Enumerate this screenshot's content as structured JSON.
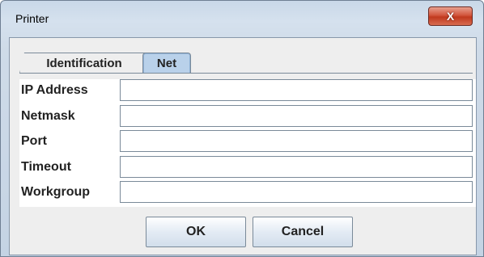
{
  "window": {
    "title": "Printer",
    "close_glyph": "X"
  },
  "tabs": [
    {
      "label": "Identification",
      "selected": false
    },
    {
      "label": "Net",
      "selected": true
    }
  ],
  "form": {
    "fields": [
      {
        "label": "IP Address",
        "value": "",
        "placeholder": ""
      },
      {
        "label": "Netmask",
        "value": "",
        "placeholder": ""
      },
      {
        "label": "Port",
        "value": "",
        "placeholder": ""
      },
      {
        "label": "Timeout",
        "value": "",
        "placeholder": ""
      },
      {
        "label": "Workgroup",
        "value": "",
        "placeholder": ""
      }
    ]
  },
  "buttons": {
    "ok": "OK",
    "cancel": "Cancel"
  },
  "colors": {
    "close_button": "#c9452a",
    "tab_selected": "#b9d1ea",
    "panel_background": "#eeeeee"
  }
}
